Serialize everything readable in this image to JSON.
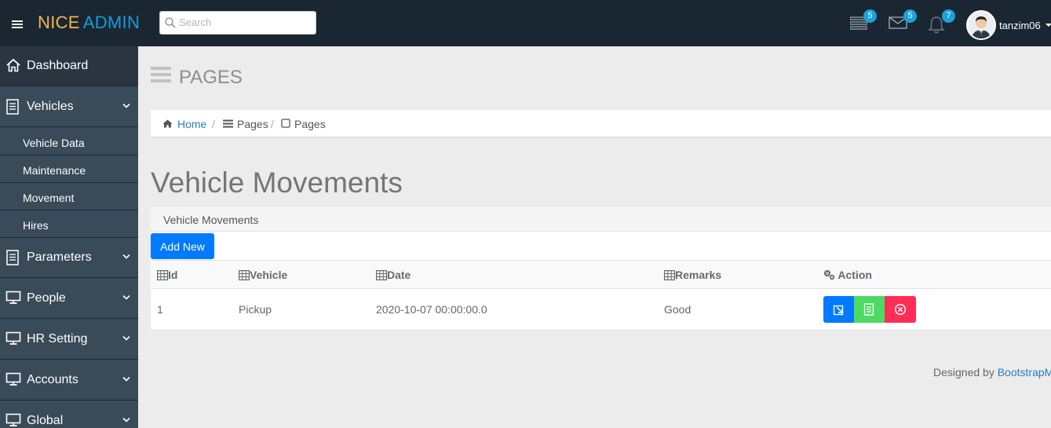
{
  "header": {
    "logo_part1": "NICE",
    "logo_part2": "ADMIN",
    "search_placeholder": "Search",
    "tasks_badge": "5",
    "mail_badge": "5",
    "notifications_badge": "7",
    "username": "tanzim06"
  },
  "sidebar": {
    "dashboard": "Dashboard",
    "vehicles": "Vehicles",
    "vehicle_subitems": [
      "Vehicle Data",
      "Maintenance",
      "Movement",
      "Hires"
    ],
    "parameters": "Parameters",
    "people": "People",
    "hr_setting": "HR Setting",
    "accounts": "Accounts",
    "global": "Global"
  },
  "page_header": {
    "title": "PAGES"
  },
  "breadcrumb": {
    "home": "Home",
    "sep": "/",
    "pages1": "Pages",
    "pages2": "Pages"
  },
  "main": {
    "title": "Vehicle Movements",
    "panel_title": "Vehicle Movements",
    "add_button": "Add New",
    "columns": {
      "id": "Id",
      "vehicle": "Vehicle",
      "date": "Date",
      "remarks": "Remarks",
      "action": "Action"
    },
    "rows": [
      {
        "id": "1",
        "vehicle": "Pickup",
        "date": "2020-10-07 00:00:00.0",
        "remarks": "Good"
      }
    ]
  },
  "footer": {
    "text": "Designed by",
    "link": "BootstrapM"
  },
  "colors": {
    "topbar": "#1a2732",
    "sidebar": "#394a59",
    "accent_blue": "#007aff",
    "accent_green": "#4cd964",
    "accent_red": "#ff2d55",
    "badge": "#19a2dc"
  }
}
